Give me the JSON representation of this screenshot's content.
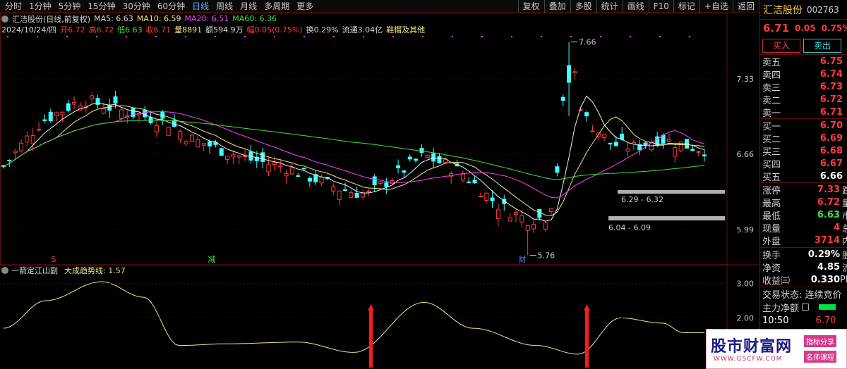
{
  "toolbar": {
    "periods": [
      "分时",
      "1分钟",
      "5分钟",
      "15分钟",
      "30分钟",
      "60分钟",
      "日线",
      "周线",
      "月线",
      "多周期",
      "更多"
    ],
    "active": "日线",
    "tools": [
      "复权",
      "叠加",
      "多股",
      "统计",
      "画线",
      "F10",
      "标记",
      "+自选",
      "返回"
    ]
  },
  "info": {
    "title": "汇洁股份(日线,前复权)",
    "ma5": "MA5: 6.63",
    "ma10": "MA10: 6.59",
    "ma20": "MA20: 6.51",
    "ma60": "MA60: 6.36",
    "date": "2024/10/24/四",
    "open": "开6.72",
    "high": "高6.72",
    "low": "低6.63",
    "close": "收6.71",
    "vol": "量8891",
    "amount": "额594.9万",
    "amp": "幅0.05(0.75%)",
    "turn": "换0.29%",
    "float": "流通3.04亿",
    "sector": "鞋帽及其他"
  },
  "chart_data": {
    "type": "candlestick",
    "price_ticks": [
      "7.33",
      "6.66",
      "5.99"
    ],
    "ind_ticks": [
      "3.00",
      "2.00"
    ],
    "annotations": {
      "high": "7.66",
      "low": "5.76",
      "range1": "6.29 - 6.32",
      "range2": "6.04 - 6.09",
      "markers": [
        "S",
        "减",
        "财"
      ]
    },
    "indicator_title": "一箭定江山副",
    "indicator_value": "大成趋势线: 1.57",
    "colors": {
      "up": "#ff3c3c",
      "down": "#40ffff",
      "ma5": "#f0f0f0",
      "ma10": "#f0e68c",
      "ma20": "#ff40ff",
      "ma60": "#40e040",
      "trend": "#f0e68c"
    }
  },
  "panel": {
    "name": "汇洁股份",
    "code": "002763",
    "price": "6.71",
    "change": "0.05",
    "pct": "0.75%",
    "buy": "买入",
    "sell": "卖出",
    "asks": [
      {
        "label": "卖五",
        "price": "6.75"
      },
      {
        "label": "卖四",
        "price": "6.74"
      },
      {
        "label": "卖三",
        "price": "6.73"
      },
      {
        "label": "卖二",
        "price": "6.72"
      },
      {
        "label": "卖一",
        "price": "6.71"
      }
    ],
    "bids": [
      {
        "label": "买一",
        "price": "6.70"
      },
      {
        "label": "买二",
        "price": "6.69"
      },
      {
        "label": "买三",
        "price": "6.68"
      },
      {
        "label": "买四",
        "price": "6.67"
      },
      {
        "label": "买五",
        "price": "6.66"
      }
    ],
    "stats": [
      {
        "label": "涨停",
        "value": "7.33",
        "extra": "跌"
      },
      {
        "label": "最高",
        "value": "6.72",
        "extra": "量"
      },
      {
        "label": "最低",
        "value": "6.63",
        "extra": "市"
      },
      {
        "label": "现量",
        "value": "4",
        "extra": "总"
      },
      {
        "label": "外盘",
        "value": "3714",
        "extra": "内"
      }
    ],
    "more": [
      {
        "label": "换手",
        "value": "0.29%",
        "extra": "股"
      },
      {
        "label": "净资",
        "value": "4.85",
        "extra": "流"
      },
      {
        "label": "收益㈢",
        "value": "0.330",
        "extra": "PE"
      }
    ],
    "trade_status": "交易状态: 连续竞价",
    "main_net": "主力净额",
    "time": "10:50",
    "time_price": "6.70"
  },
  "watermark": {
    "big": "股市财富网",
    "url": "WWW.GSCFW.COM",
    "tag1": "指标分享",
    "tag2": "名师课程"
  }
}
